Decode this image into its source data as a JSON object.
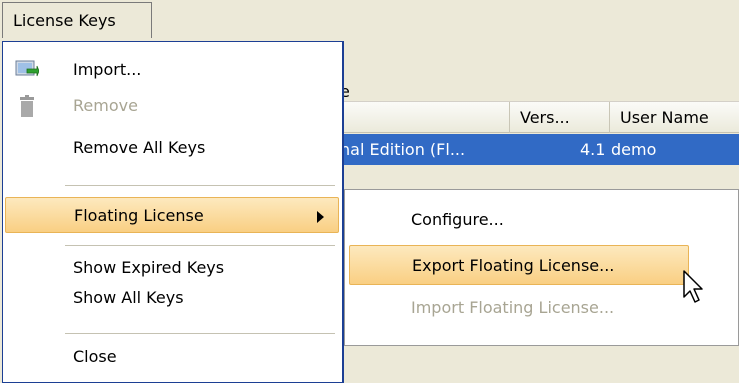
{
  "menubar": {
    "license_keys": "License Keys"
  },
  "background": {
    "fragment": "e",
    "columns": {
      "vers": "Vers...",
      "user": "User Name"
    },
    "row": {
      "name": "nal Edition (Fl...",
      "version": "4.1",
      "user": "demo"
    }
  },
  "menu": {
    "items": [
      {
        "label": "Import...",
        "icon": "import-icon",
        "enabled": true
      },
      {
        "label": "Remove",
        "icon": "trash-icon",
        "enabled": false
      },
      {
        "label": "Remove All Keys",
        "enabled": true
      },
      {
        "label": "Floating License",
        "enabled": true,
        "submenu": true,
        "highlighted": true
      },
      {
        "label": "Show Expired Keys",
        "enabled": true
      },
      {
        "label": "Show All Keys",
        "enabled": true
      },
      {
        "label": "Close",
        "enabled": true
      }
    ]
  },
  "submenu": {
    "items": [
      {
        "label": "Configure...",
        "enabled": true
      },
      {
        "label": "Export Floating License...",
        "enabled": true,
        "highlighted": true
      },
      {
        "label": "Import Floating License...",
        "enabled": false
      }
    ]
  },
  "colors": {
    "selection_row": "#316ac5",
    "menu_highlight_top": "#fde9be",
    "menu_highlight_bottom": "#f9cf83",
    "menu_border": "#1c3f94"
  }
}
